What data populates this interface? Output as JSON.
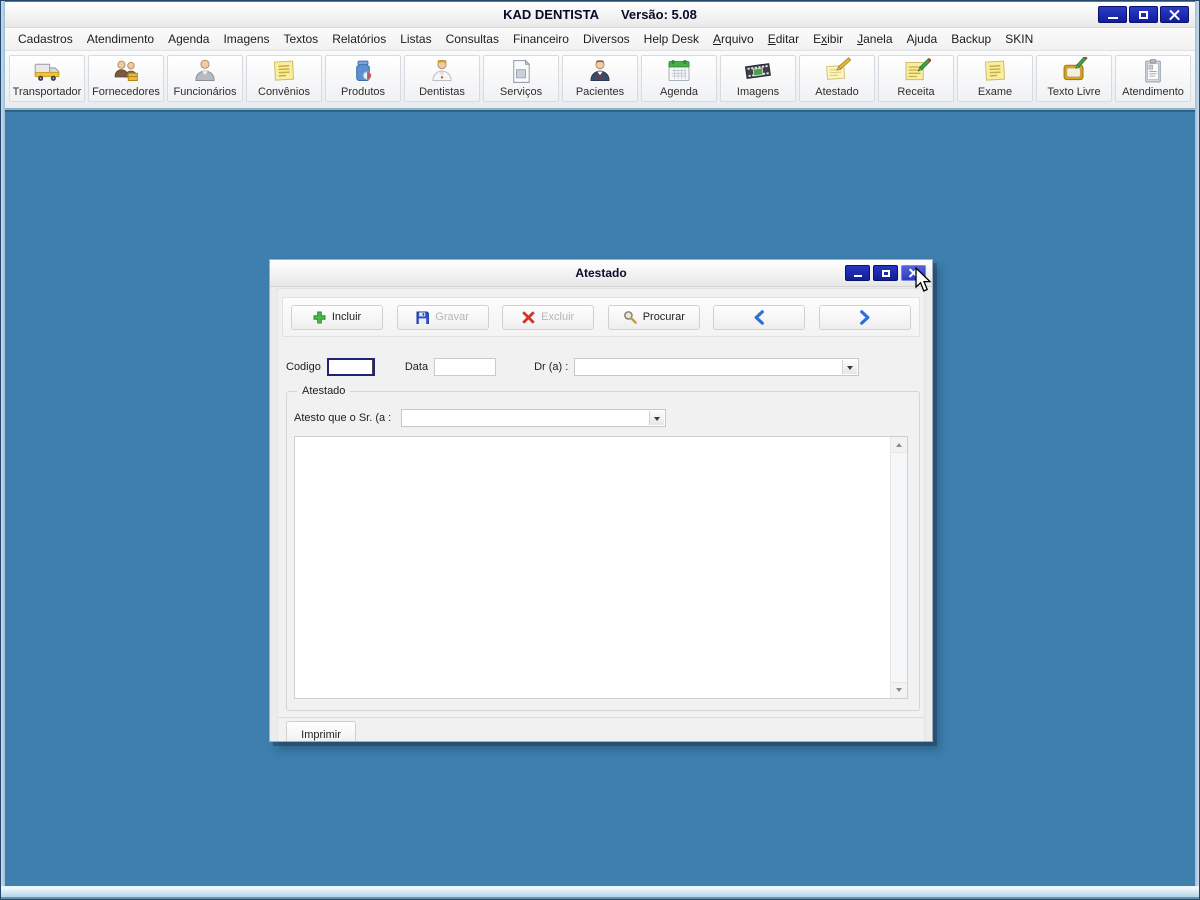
{
  "window": {
    "title": "KAD DENTISTA",
    "version": "Versão: 5.08",
    "controls": {
      "minimize_icon": "minimize-icon",
      "maximize_icon": "maximize-icon",
      "close_icon": "close-icon"
    }
  },
  "menu": {
    "items": [
      {
        "label": "Cadastros",
        "u": -1
      },
      {
        "label": "Atendimento",
        "u": -1
      },
      {
        "label": "Agenda",
        "u": -1
      },
      {
        "label": "Imagens",
        "u": -1
      },
      {
        "label": "Textos",
        "u": -1
      },
      {
        "label": "Relatórios",
        "u": -1
      },
      {
        "label": "Listas",
        "u": -1
      },
      {
        "label": "Consultas",
        "u": -1
      },
      {
        "label": "Financeiro",
        "u": -1
      },
      {
        "label": "Diversos",
        "u": -1
      },
      {
        "label": "Help Desk",
        "u": -1
      },
      {
        "label": "Arquivo",
        "u": 0
      },
      {
        "label": "Editar",
        "u": 0
      },
      {
        "label": "Exibir",
        "u": 1
      },
      {
        "label": "Janela",
        "u": 0
      },
      {
        "label": "Ajuda",
        "u": -1
      },
      {
        "label": "Backup",
        "u": -1
      },
      {
        "label": "SKIN",
        "u": -1
      }
    ]
  },
  "toolbar": {
    "buttons": [
      {
        "label": "Transportador",
        "icon": "truck-icon"
      },
      {
        "label": "Fornecedores",
        "icon": "suppliers-people-icon"
      },
      {
        "label": "Funcionários",
        "icon": "employee-person-icon"
      },
      {
        "label": "Convênios",
        "icon": "yellow-note-icon"
      },
      {
        "label": "Produtos",
        "icon": "product-jar-icon"
      },
      {
        "label": "Dentistas",
        "icon": "dentist-person-icon"
      },
      {
        "label": "Serviços",
        "icon": "document-page-icon"
      },
      {
        "label": "Pacientes",
        "icon": "patient-person-icon"
      },
      {
        "label": "Agenda",
        "icon": "calendar-icon"
      },
      {
        "label": "Imagens",
        "icon": "film-strip-icon"
      },
      {
        "label": "Atestado",
        "icon": "sheet-pencil-icon"
      },
      {
        "label": "Receita",
        "icon": "note-green-pencil-icon"
      },
      {
        "label": "Exame",
        "icon": "yellow-note-icon"
      },
      {
        "label": "Texto Livre",
        "icon": "pad-pencil-icon"
      },
      {
        "label": "Atendimento",
        "icon": "clipboard-icon"
      }
    ]
  },
  "dialog": {
    "title": "Atestado",
    "buttons": {
      "incluir": "Incluir",
      "gravar": "Gravar",
      "excluir": "Excluir",
      "procurar": "Procurar"
    },
    "fields": {
      "codigo_label": "Codigo",
      "codigo_value": "",
      "data_label": "Data",
      "data_value": "",
      "dr_label": "Dr (a) :",
      "dr_value": ""
    },
    "group": {
      "title": "Atestado",
      "atesto_label": "Atesto que o Sr. (a  :",
      "atesto_value": "",
      "body_value": ""
    },
    "imprimir_label": "Imprimir"
  },
  "colors": {
    "desktop_blue": "#3e7fae",
    "control_navy": "#1a26ab",
    "arrow_blue": "#2a6fd6",
    "disabled_text": "#b6b6b6"
  }
}
